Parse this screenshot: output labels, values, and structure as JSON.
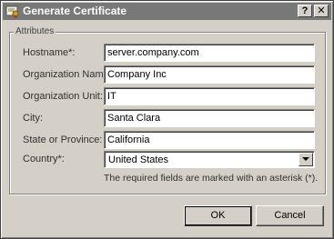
{
  "window": {
    "title": "Generate Certificate",
    "help_label": "?",
    "close_label": "✕"
  },
  "group": {
    "legend": "Attributes"
  },
  "fields": [
    {
      "label": "Hostname*:",
      "value": "server.company.com"
    },
    {
      "label": "Organization Name:",
      "value": "Company Inc"
    },
    {
      "label": "Organization Unit:",
      "value": "IT"
    },
    {
      "label": "City:",
      "value": "Santa Clara"
    },
    {
      "label": "State or Province:",
      "value": "California"
    }
  ],
  "country": {
    "label": "Country*:",
    "selected": "United States"
  },
  "hint": "The required fields are marked with an asterisk (*).",
  "buttons": {
    "ok": "OK",
    "cancel": "Cancel"
  },
  "icons": {
    "title_icon": "certificate-icon",
    "dropdown": "chevron-down-icon"
  }
}
